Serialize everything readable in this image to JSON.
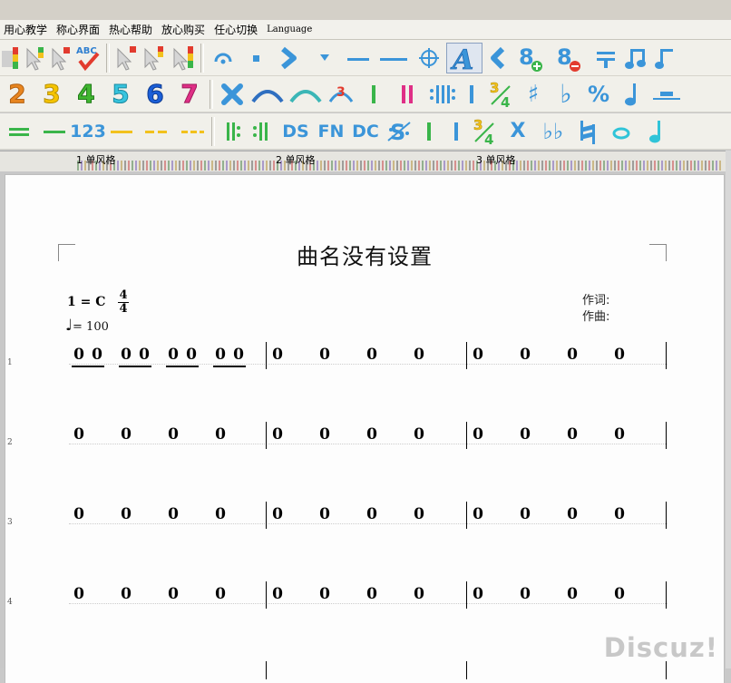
{
  "menu": [
    {
      "label": "用心教学"
    },
    {
      "label": "称心界面"
    },
    {
      "label": "热心帮助"
    },
    {
      "label": "放心购买"
    },
    {
      "label": "任心切换"
    },
    {
      "label": "Language"
    }
  ],
  "toolbar1": {
    "spell_check_label": "ABC",
    "highlighted_button": "text-A-button",
    "colors": {
      "blue": "#3b95d9",
      "red": "#e23b2e",
      "green": "#3ab54a",
      "yellow": "#f2c11d"
    }
  },
  "toolbar2": {
    "digits": [
      {
        "label": "2",
        "color": "#e8851f"
      },
      {
        "label": "3",
        "color": "#f5c400"
      },
      {
        "label": "4",
        "color": "#40b630"
      },
      {
        "label": "5",
        "color": "#37c4de"
      },
      {
        "label": "6",
        "color": "#1b5fd8"
      },
      {
        "label": "7",
        "color": "#df2f86"
      }
    ],
    "time_sig": {
      "top": "3",
      "bottom": "4"
    },
    "sharp": "♯",
    "flat": "♭",
    "percent": "%"
  },
  "toolbar3": {
    "numbers_label": "123",
    "ds_label": "DS",
    "fn_label": "FN",
    "dc_label": "DC",
    "time_sig": {
      "top": "3",
      "bottom": "4"
    },
    "x_label": "X",
    "double_flat": "♭♭"
  },
  "ruler": {
    "sections": [
      {
        "label": "1 单风格"
      },
      {
        "label": "2 单风格"
      },
      {
        "label": "3 单风格"
      }
    ]
  },
  "score": {
    "title": "曲名没有设置",
    "key": "1 = C",
    "time_top": "4",
    "time_bottom": "4",
    "tempo_note": "♩",
    "tempo_value": "= 100",
    "lyricist_label": "作词:",
    "composer_label": "作曲:",
    "row_numbers": [
      "1",
      "2",
      "3",
      "4"
    ],
    "rest_symbol": "0"
  },
  "watermark": "Discuz!"
}
